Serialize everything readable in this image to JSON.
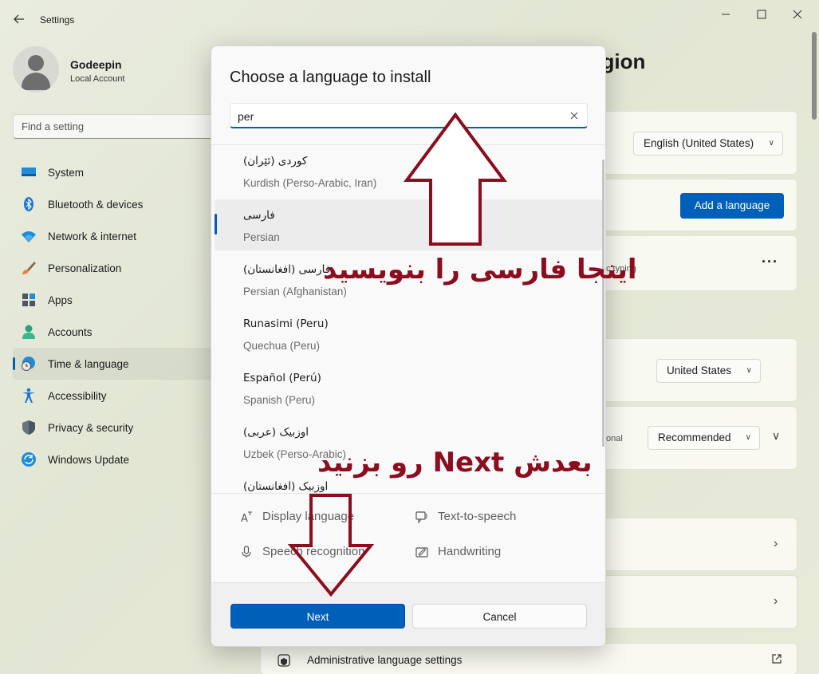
{
  "window": {
    "app_title": "Settings"
  },
  "profile": {
    "name": "Godeepin",
    "account_type": "Local Account"
  },
  "search": {
    "placeholder": "Find a setting"
  },
  "sidebar": {
    "items": [
      {
        "label": "System",
        "icon": "monitor-icon"
      },
      {
        "label": "Bluetooth & devices",
        "icon": "bluetooth-icon"
      },
      {
        "label": "Network & internet",
        "icon": "wifi-icon"
      },
      {
        "label": "Personalization",
        "icon": "brush-icon"
      },
      {
        "label": "Apps",
        "icon": "apps-icon"
      },
      {
        "label": "Accounts",
        "icon": "person-icon"
      },
      {
        "label": "Time & language",
        "icon": "globe-clock-icon",
        "active": true
      },
      {
        "label": "Accessibility",
        "icon": "accessibility-icon"
      },
      {
        "label": "Privacy & security",
        "icon": "shield-icon"
      },
      {
        "label": "Windows Update",
        "icon": "update-icon"
      }
    ]
  },
  "background_page": {
    "title_fragment": "egion",
    "display_language_value": "English (United States)",
    "add_language_label": "Add a language",
    "typing_fragment": "c typing",
    "region_value": "United States",
    "format_fragment": "onal",
    "format_value": "Recommended",
    "admin_settings_label": "Administrative language settings"
  },
  "dialog": {
    "title": "Choose a language to install",
    "search_value": "per",
    "languages": [
      {
        "native": "کوردی (ئێران)",
        "english": "Kurdish (Perso-Arabic, Iran)"
      },
      {
        "native": "فارسی",
        "english": "Persian",
        "selected": true
      },
      {
        "native": "فارسی (افغانستان)",
        "english": "Persian (Afghanistan)"
      },
      {
        "native": "Runasimi (Peru)",
        "english": "Quechua (Peru)"
      },
      {
        "native": "Español (Perú)",
        "english": "Spanish (Peru)"
      },
      {
        "native": "اوزبیک (عربی)",
        "english": "Uzbek (Perso-Arabic)"
      },
      {
        "native": "اوزبیک (افغانستان)",
        "english": ""
      }
    ],
    "features": {
      "display_language": "Display language",
      "text_to_speech": "Text-to-speech",
      "speech_recognition": "Speech recognition",
      "handwriting": "Handwriting"
    },
    "next_label": "Next",
    "cancel_label": "Cancel"
  },
  "annotations": {
    "top_text": "اینجا فارسی را بنویسید",
    "bottom_text": "بعدش Next رو بزنید",
    "color": "#8b0d1e"
  },
  "colors": {
    "accent": "#005fb8"
  }
}
